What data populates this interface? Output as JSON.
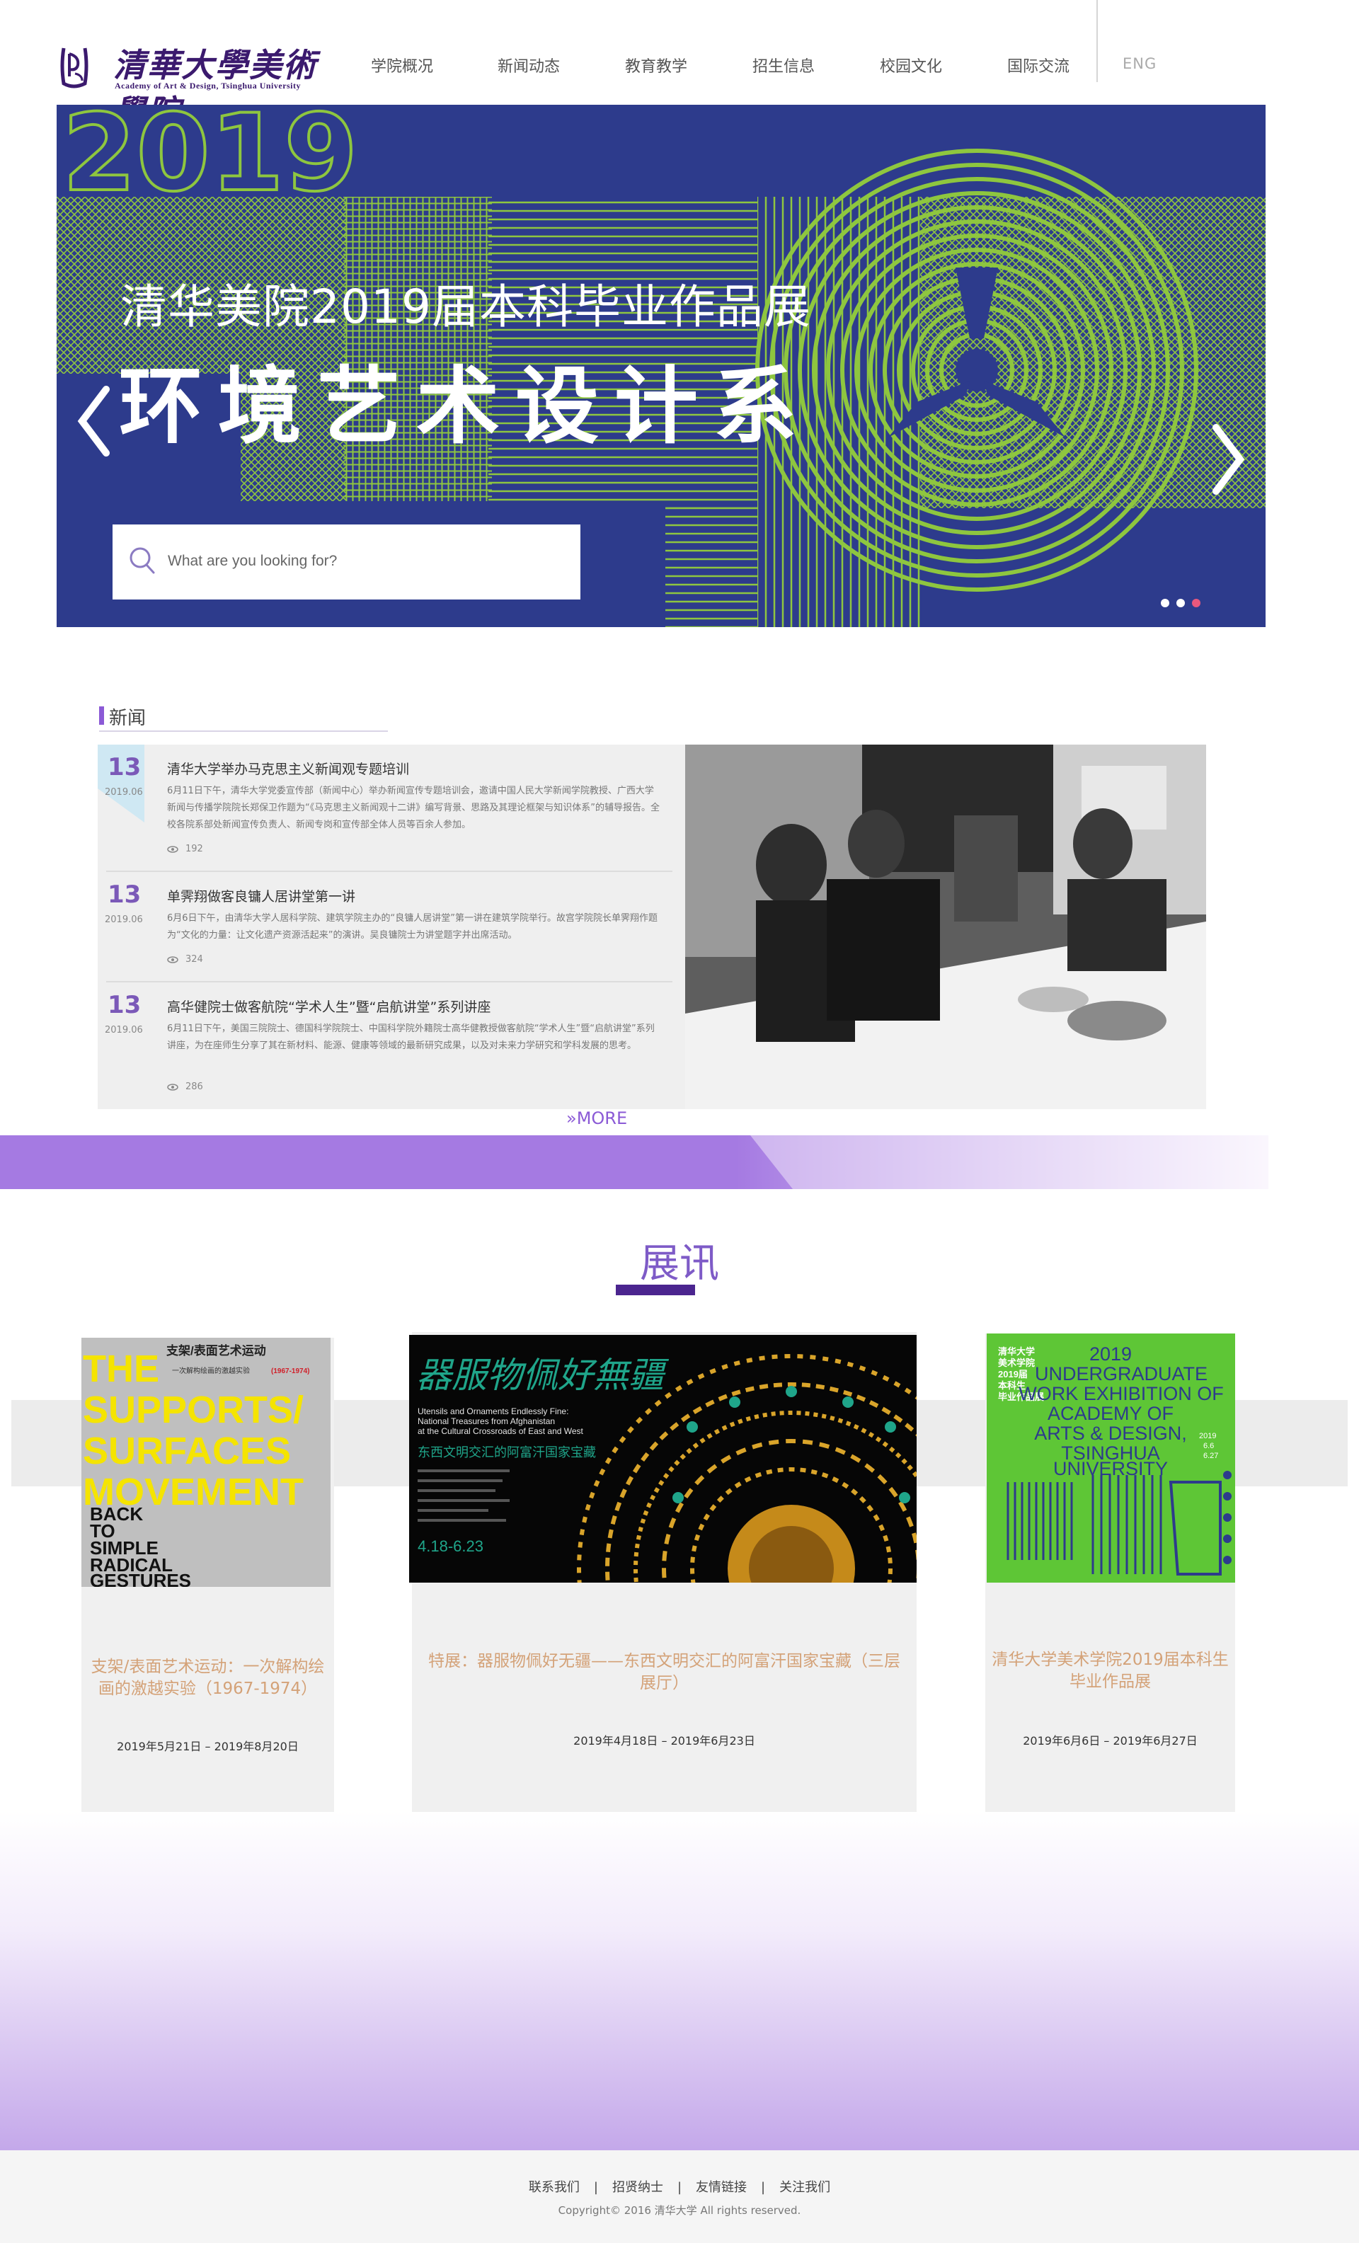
{
  "brand": {
    "cn": "清華大學美術學院",
    "en": "Academy of Art & Design, Tsinghua University"
  },
  "nav": {
    "items": [
      "学院概况",
      "新闻动态",
      "教育教学",
      "招生信息",
      "校园文化",
      "国际交流"
    ],
    "lang": "ENG"
  },
  "banner": {
    "year": "2019",
    "subtitle": "清华美院2019届本科毕业作品展",
    "title": "环境艺术设计系",
    "search_placeholder": "What are you looking for?",
    "slide_count": 3,
    "active_slide": 3,
    "colors": {
      "bg": "#2d3b8c",
      "green": "#8ec63f",
      "active_dot": "#e8587d"
    }
  },
  "news": {
    "heading": "新闻",
    "items": [
      {
        "day": "13",
        "ym": "2019.06",
        "title": "清华大学举办马克思主义新闻观专题培训",
        "desc": "6月11日下午，清华大学党委宣传部（新闻中心）举办新闻宣传专题培训会，邀请中国人民大学新闻学院教授、广西大学新闻与传播学院院长郑保卫作题为“《马克思主义新闻观十二讲》编写背景、思路及其理论框架与知识体系”的辅导报告。全校各院系部处新闻宣传负责人、新闻专岗和宣传部全体人员等百余人参加。",
        "views": "192"
      },
      {
        "day": "13",
        "ym": "2019.06",
        "title": "单霁翔做客良镛人居讲堂第一讲",
        "desc": "6月6日下午，由清华大学人居科学院、建筑学院主办的“良镛人居讲堂”第一讲在建筑学院举行。故宫学院院长单霁翔作题为“文化的力量：让文化遗产资源活起来”的演讲。吴良镛院士为讲堂题字并出席活动。",
        "views": "324"
      },
      {
        "day": "13",
        "ym": "2019.06",
        "title": "高华健院士做客航院“学术人生”暨“启航讲堂”系列讲座",
        "desc": "6月11日下午，美国三院院士、德国科学院院士、中国科学院外籍院士高华健教授做客航院“学术人生”暨“启航讲堂”系列讲座，为在座师生分享了其在新材料、能源、健康等领域的最新研究成果，以及对未来力学研究和学科发展的思考。",
        "views": "286"
      }
    ],
    "more": "MORE"
  },
  "exhibitions": {
    "heading": "展讯",
    "cards": [
      {
        "title": "支架/表面艺术运动：一次解构绘画的激越实验（1967-1974）",
        "date": "2019年5月21日 – 2019年8月20日",
        "poster": {
          "header_cn": "支架/表面艺术运动",
          "sub_cn": "一次解构绘画的激越实验",
          "years": "(1967-1974)",
          "lines_yellow": [
            "THE",
            "SUPPORTS/",
            "SURFACES",
            "MOVEMENT"
          ],
          "lines_black": [
            "BACK",
            "TO",
            "SIMPLE",
            "RADICAL",
            "GESTURES"
          ]
        }
      },
      {
        "title": "特展：器服物佩好无疆——东西文明交汇的阿富汗国家宝藏（三层展厅）",
        "date": "2019年4月18日 – 2019年6月23日",
        "poster": {
          "title_cn": "器服物佩好無疆",
          "en_lines": [
            "Utensils and Ornaments Endlessly Fine:",
            "National Treasures from Afghanistan",
            "at the Cultural Crossroads of East and West"
          ],
          "sub_cn": "东西文明交汇的阿富汗国家宝藏",
          "dates": "4.18-6.23"
        }
      },
      {
        "title": "清华大学美术学院2019届本科生毕业作品展",
        "date": "2019年6月6日 – 2019年6月27日",
        "poster": {
          "header_cn": [
            "清华大学",
            "美术学院",
            "2019届",
            "本科生",
            "毕业作品展"
          ],
          "en_lines": [
            "2019",
            "UNDERGRADUATE",
            "WORK EXHIBITION OF",
            "ACADEMY OF",
            "ARTS & DESIGN,",
            "TSINGHUA",
            "UNIVERSITY"
          ],
          "dates": [
            "2019",
            "6.6",
            "6.27"
          ]
        }
      }
    ]
  },
  "footer": {
    "links": [
      "联系我们",
      "招贤纳士",
      "友情链接",
      "关注我们"
    ],
    "separator": "|",
    "copyright": "Copyright© 2016  清华大学  All rights reserved."
  },
  "colors": {
    "accent": "#8b5ad6",
    "brand_purple": "#3b1a6e",
    "exh_title": "#7e5bc7",
    "card_title": "#d4a278"
  }
}
